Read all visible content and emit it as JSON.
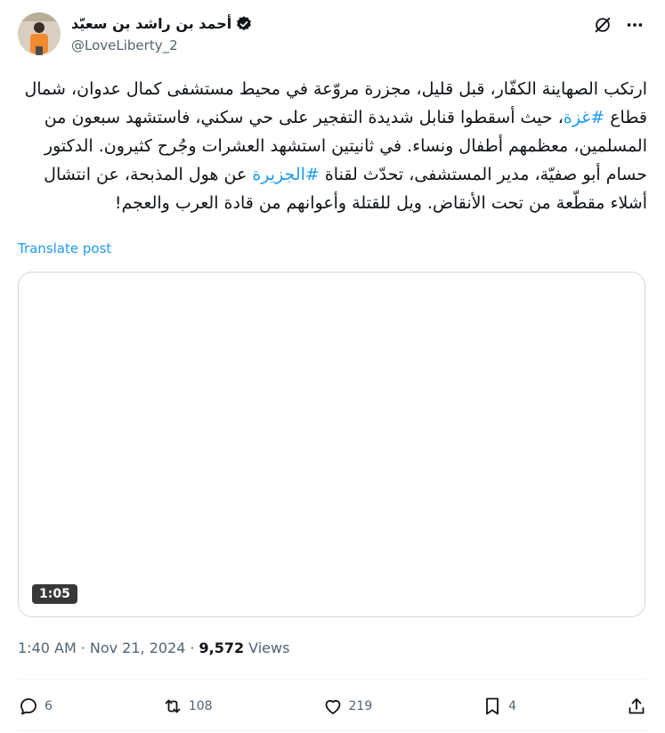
{
  "author": {
    "display_name": "أحمد بن راشد بن سعيّد",
    "handle": "@LoveLiberty_2"
  },
  "tweet": {
    "text_before_tag1": "ارتكب الصهاينة الكفّار، قبل قليل، مجزرة مروّعة في محيط مستشفى كمال عدوان، شمال قطاع ",
    "hashtag1": "#غزة",
    "text_between": "، حيث أسقطوا قنابل شديدة التفجير على حي سكني، فاستشهد سبعون من المسلمين، معظمهم أطفال ونساء. في ثانيتين استشهد العشرات وجُرح كثيرون. الدكتور حسام أبو صفيّة، مدير المستشفى، تحدّث لقناة ",
    "hashtag2": "#الجزيرة",
    "text_after": " عن هول المذبحة، عن انتشال أشلاء مقطّعة من تحت الأنقاض. ويل للقتلة وأعوانهم من قادة العرب والعجم!"
  },
  "translate_label": "Translate post",
  "media": {
    "duration": "1:05"
  },
  "meta": {
    "time": "1:40 AM",
    "sep1": "·",
    "date": "Nov 21, 2024",
    "sep2": "·",
    "views_count": "9,572",
    "views_label": "Views"
  },
  "actions": {
    "replies": "6",
    "reposts": "108",
    "likes": "219",
    "bookmarks": "4"
  },
  "colors": {
    "accent": "#1d9bf0",
    "muted": "#536471",
    "text": "#0f1419"
  }
}
